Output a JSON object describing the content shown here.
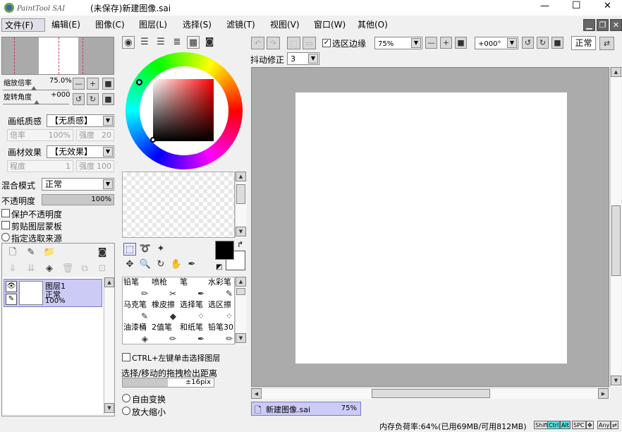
{
  "app": {
    "logo_text": "PaintTool SAI",
    "title": "(未保存)新建图像.sai"
  },
  "window_controls": {
    "minimize": "—",
    "maximize": "☐",
    "close": "✕"
  },
  "menu": [
    "文件(F)",
    "编辑(E)",
    "图像(C)",
    "图层(L)",
    "选择(S)",
    "滤镜(T)",
    "视图(V)",
    "窗口(W)",
    "其他(O)"
  ],
  "navigator": {
    "zoom_label": "缩放倍率",
    "zoom_value": "75.0%",
    "rotate_label": "旋转角度",
    "rotate_value": "+000"
  },
  "layer_props": {
    "paper_label": "画纸质感",
    "paper_value": "【无质感】",
    "rate_label": "倍率",
    "rate_value": "100%",
    "strength_label": "强度",
    "strength_value": "20",
    "effect_label": "画材效果",
    "effect_value": "【无效果】",
    "degree_label": "程度",
    "degree_value": "1",
    "strength2_label": "强度",
    "strength2_value": "100",
    "blend_label": "混合模式",
    "blend_value": "正常",
    "opacity_label": "不透明度",
    "opacity_value": "100%",
    "opacity_fraction": 1.0,
    "protect_opacity": "保护不透明度",
    "clip_mask": "剪贴图层蒙板",
    "selection_source": "指定选取来源"
  },
  "layer": {
    "name": "图层1",
    "mode": "正常",
    "opacity": "100%"
  },
  "tools": {
    "ctrl_select_label": "CTRL+左键单击选择图层",
    "drag_distance_label": "选择/移动的拖拽检出距离",
    "drag_distance_value": "±16pix",
    "free_transform": "自由变换",
    "zoom_in_out": "放大缩小",
    "brushes": [
      [
        "铅笔",
        "喷枪",
        "笔",
        "水彩笔"
      ],
      [
        "马克笔",
        "橡皮擦",
        "选择笔",
        "选区擦"
      ],
      [
        "油漆桶",
        "2值笔",
        "和纸笔",
        "铅笔30"
      ]
    ]
  },
  "toolbar": {
    "selection_edge": "选区边缘",
    "zoom_value": "75%",
    "rotate_value": "+000°",
    "mode_value": "正常",
    "stabilizer_label": "抖动修正",
    "stabilizer_value": "3"
  },
  "document_tab": {
    "name": "新建图像.sai",
    "zoom": "75%"
  },
  "status": {
    "memory": "内存负荷率:64%(已用69MB/可用812MB)",
    "keys": [
      "Shift",
      "Ctrl",
      "Alt",
      "SPC",
      "✥",
      "Any",
      "⇄"
    ]
  },
  "colors": {
    "accent_cyan": "#56e0e0",
    "layer_selected": "#cbcbf5",
    "canvas_bg": "#ababab",
    "doc_tab_bg": "#cbcbf5"
  }
}
